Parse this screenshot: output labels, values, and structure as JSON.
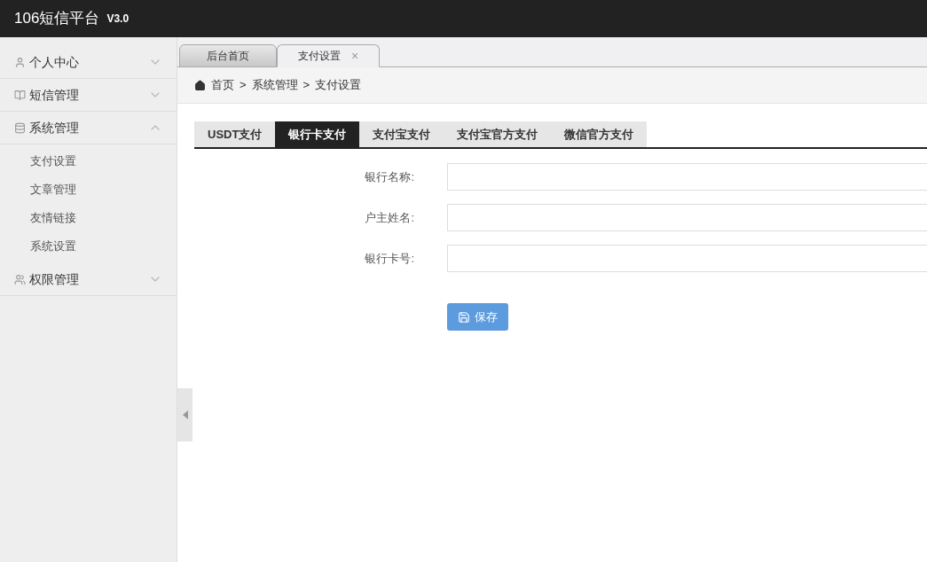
{
  "header": {
    "title": "106短信平台",
    "version": "V3.0"
  },
  "sidebar": {
    "items": [
      {
        "label": "个人中心",
        "expanded": false
      },
      {
        "label": "短信管理",
        "expanded": false
      },
      {
        "label": "系统管理",
        "expanded": true,
        "children": [
          {
            "label": "支付设置"
          },
          {
            "label": "文章管理"
          },
          {
            "label": "友情链接"
          },
          {
            "label": "系统设置"
          }
        ]
      },
      {
        "label": "权限管理",
        "expanded": false
      }
    ]
  },
  "page_tabs": [
    {
      "label": "后台首页",
      "selected": false
    },
    {
      "label": "支付设置",
      "selected": true,
      "close": "×"
    }
  ],
  "breadcrumb": [
    "首页",
    "系统管理",
    "支付设置"
  ],
  "breadcrumb_separator": ">",
  "payment_tabs": [
    {
      "label": "USDT支付",
      "selected": false
    },
    {
      "label": "银行卡支付",
      "selected": true
    },
    {
      "label": "支付宝支付",
      "selected": false
    },
    {
      "label": "支付宝官方支付",
      "selected": false
    },
    {
      "label": "微信官方支付",
      "selected": false
    }
  ],
  "form": {
    "fields": [
      {
        "label": "银行名称:"
      },
      {
        "label": "户主姓名:"
      },
      {
        "label": "银行卡号:"
      }
    ],
    "save_button": "保存"
  }
}
